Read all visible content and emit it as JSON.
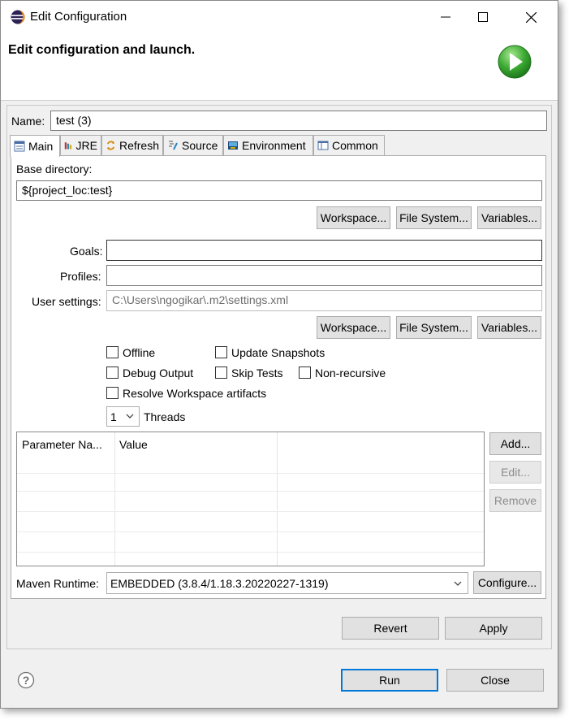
{
  "window": {
    "title": "Edit Configuration"
  },
  "banner": {
    "heading": "Edit configuration and launch."
  },
  "name_field": {
    "label": "Name:",
    "value": "test (3)"
  },
  "tabs": [
    {
      "label": "Main",
      "icon": "main-tab-icon"
    },
    {
      "label": "JRE",
      "icon": "jre-icon"
    },
    {
      "label": "Refresh",
      "icon": "refresh-icon"
    },
    {
      "label": "Source",
      "icon": "source-icon"
    },
    {
      "label": "Environment",
      "icon": "environment-icon"
    },
    {
      "label": "Common",
      "icon": "common-icon"
    }
  ],
  "main": {
    "base_dir_label": "Base directory:",
    "base_dir_value": "${project_loc:test}",
    "workspace_btn": "Workspace...",
    "filesystem_btn": "File System...",
    "variables_btn": "Variables...",
    "goals_label": "Goals:",
    "goals_value": "",
    "profiles_label": "Profiles:",
    "profiles_value": "",
    "user_settings_label": "User settings:",
    "user_settings_value": "C:\\Users\\ngogikar\\.m2\\settings.xml",
    "workspace_btn2": "Workspace...",
    "filesystem_btn2": "File System...",
    "variables_btn2": "Variables...",
    "checkboxes": {
      "offline": "Offline",
      "update_snapshots": "Update Snapshots",
      "debug_output": "Debug Output",
      "skip_tests": "Skip Tests",
      "non_recursive": "Non-recursive",
      "resolve_workspace": "Resolve Workspace artifacts"
    },
    "threads_value": "1",
    "threads_label": "Threads",
    "table": {
      "col_name": "Parameter Na...",
      "col_value": "Value"
    },
    "add_btn": "Add...",
    "edit_btn": "Edit...",
    "remove_btn": "Remove",
    "maven_runtime_label": "Maven Runtime:",
    "maven_runtime_value": "EMBEDDED (3.8.4/1.18.3.20220227-1319)",
    "configure_btn": "Configure..."
  },
  "footer": {
    "revert_btn": "Revert",
    "apply_btn": "Apply",
    "run_btn": "Run",
    "close_btn": "Close"
  },
  "colors": {
    "accent": "#0078d7",
    "run_green": "#3aa832"
  }
}
